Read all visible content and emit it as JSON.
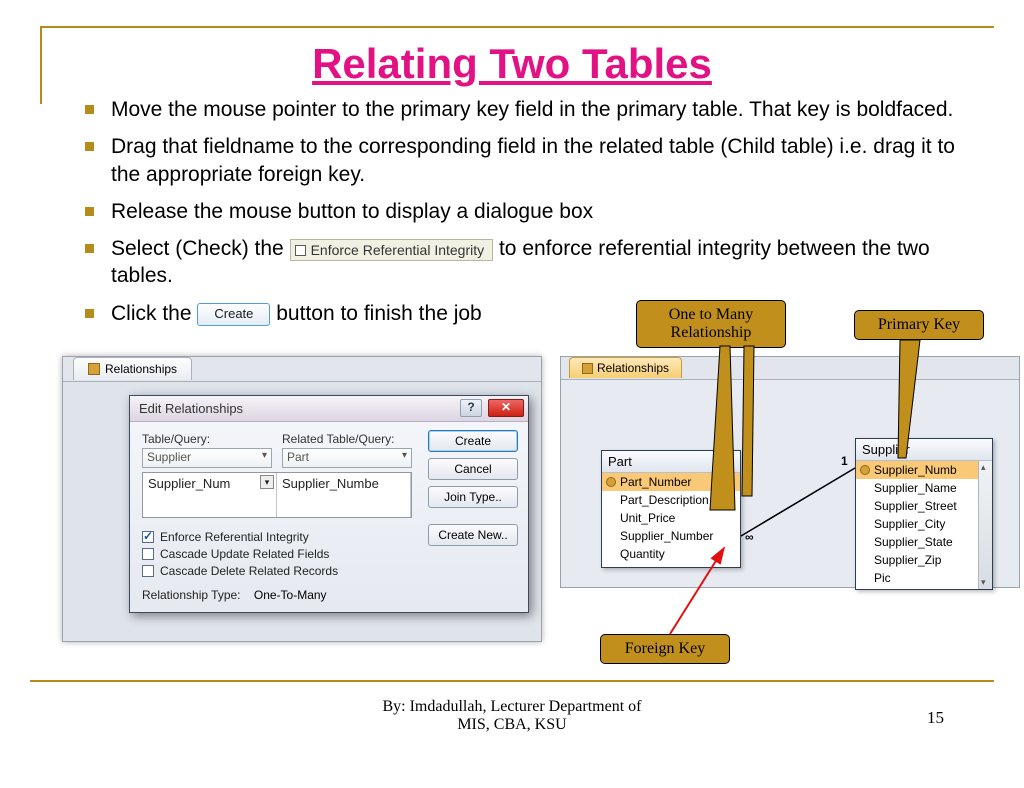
{
  "title": "Relating Two Tables",
  "bullets": [
    "Move the mouse pointer to the primary key field in the primary table. That key is boldfaced.",
    "Drag that fieldname to the corresponding field in the related table (Child table) i.e. drag it to the appropriate foreign key.",
    "Release the mouse button to display a dialogue box"
  ],
  "bullet4_a": "Select (Check) the",
  "bullet4_chip": "Enforce Referential Integrity",
  "bullet4_b": "to enforce referential integrity between the two tables.",
  "bullet5_a": "Click the",
  "bullet5_btn": "Create",
  "bullet5_b": "button to finish the job",
  "callouts": {
    "one_many": "One to Many\nRelationship",
    "pk": "Primary Key",
    "fk": "Foreign Key"
  },
  "left": {
    "tab": "Relationships",
    "dlg_title": "Edit Relationships",
    "lbl_table": "Table/Query:",
    "lbl_related": "Related Table/Query:",
    "combo_table": "Supplier",
    "combo_related": "Part",
    "cell_a": "Supplier_Num",
    "cell_b": "Supplier_Numbe",
    "btn_create": "Create",
    "btn_cancel": "Cancel",
    "btn_join": "Join Type..",
    "btn_new": "Create New..",
    "chk1": "Enforce Referential Integrity",
    "chk2": "Cascade Update Related Fields",
    "chk3": "Cascade Delete Related Records",
    "reltype_lbl": "Relationship Type:",
    "reltype_val": "One-To-Many"
  },
  "right": {
    "tab": "Relationships",
    "part": {
      "title": "Part",
      "rows": [
        "Part_Number",
        "Part_Description",
        "Unit_Price",
        "Supplier_Number",
        "Quantity"
      ]
    },
    "supplier": {
      "title": "Supplier",
      "rows": [
        "Supplier_Numb",
        "Supplier_Name",
        "Supplier_Street",
        "Supplier_City",
        "Supplier_State",
        "Supplier_Zip",
        "Pic"
      ]
    },
    "one": "1",
    "inf": "∞"
  },
  "footer": "By: Imdadullah, Lecturer Department of\nMIS, CBA, KSU",
  "page": "15"
}
